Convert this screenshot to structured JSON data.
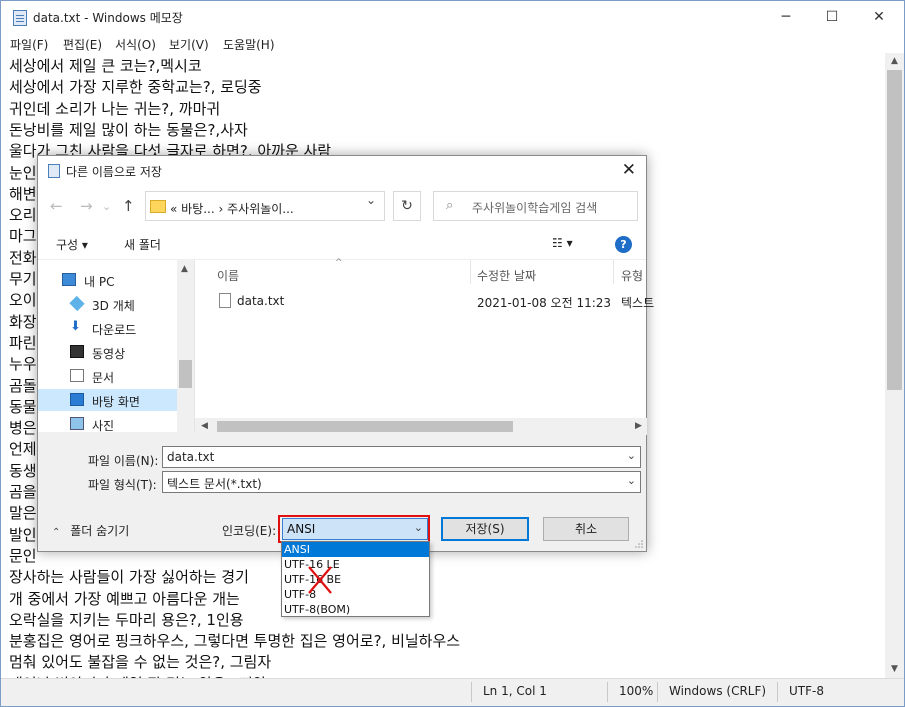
{
  "window": {
    "title": "data.txt - Windows 메모장",
    "controls": {
      "minimize": "─",
      "maximize": "☐",
      "close": "✕"
    }
  },
  "menu": [
    "파일(F)",
    "편집(E)",
    "서식(O)",
    "보기(V)",
    "도움말(H)"
  ],
  "editor_lines": [
    "세상에서 제일 큰 코는?,멕시코",
    "세상에서 가장 지루한 중학교는?, 로딩중",
    "귀인데 소리가 나는 귀는?, 까마귀",
    "돈낭비를 제일 많이 하는 동물은?,사자",
    "울다가 그친 사람을 다섯 글자로 하면?, 아까운 사람",
    "눈인",
    "해변",
    "오리",
    "마그",
    "전화",
    "무기",
    "오이",
    "화장",
    "파린",
    "누우",
    "곰돌",
    "동물",
    "병은",
    "언제",
    "동생",
    "곰을",
    "말은",
    "발인",
    "문인",
    "장사하는 사람들이 가장 싫어하는 경기",
    "개 중에서 가장 예쁘고 아름다운 개는",
    "오락실을 지키는 두마리 용은?, 1인용",
    "분홍집은 영어로 핑크하우스, 그렇다면 투명한 집은 영어로?, 비닐하우스",
    "멈춰 있어도 불잡을 수 없는 것은?, 그림자",
    "태어난 병아리가 제일 잘 먹는 약은?,삐약"
  ],
  "status": {
    "position": "Ln 1, Col 1",
    "zoom": "100%",
    "line_ending": "Windows (CRLF)",
    "encoding": "UTF-8"
  },
  "dialog": {
    "title": "다른 이름으로 저장",
    "close": "✕",
    "address": "« 바탕...  ›  주사위놀이...",
    "search_placeholder": "주사위놀이학습게임 검색",
    "organize": "구성 ▾",
    "new_folder": "새 폴더",
    "view_icon": "☷ ▾",
    "help": "?",
    "nav_items": [
      {
        "label": "내 PC",
        "icon": "pc-icon"
      },
      {
        "label": "3D 개체",
        "icon": "cube-icon"
      },
      {
        "label": "다운로드",
        "icon": "download-icon"
      },
      {
        "label": "동영상",
        "icon": "video-icon"
      },
      {
        "label": "문서",
        "icon": "document-icon"
      },
      {
        "label": "바탕 화면",
        "icon": "desktop-icon"
      },
      {
        "label": "사진",
        "icon": "picture-icon"
      }
    ],
    "columns": {
      "name": "이름",
      "modified": "수정한 날짜",
      "type": "유형"
    },
    "files": [
      {
        "name": "data.txt",
        "modified": "2021-01-08 오전 11:23",
        "type": "텍스트"
      }
    ],
    "filename_label": "파일 이름(N):",
    "filename_value": "data.txt",
    "filetype_label": "파일 형식(T):",
    "filetype_value": "텍스트 문서(*.txt)",
    "hide_folders": "폴더 숨기기",
    "encoding_label": "인코딩(E):",
    "encoding_value": "ANSI",
    "save_button": "저장(S)",
    "cancel_button": "취소",
    "encoding_options": [
      "ANSI",
      "UTF-16 LE",
      "UTF-16 BE",
      "UTF-8",
      "UTF-8(BOM)"
    ]
  }
}
